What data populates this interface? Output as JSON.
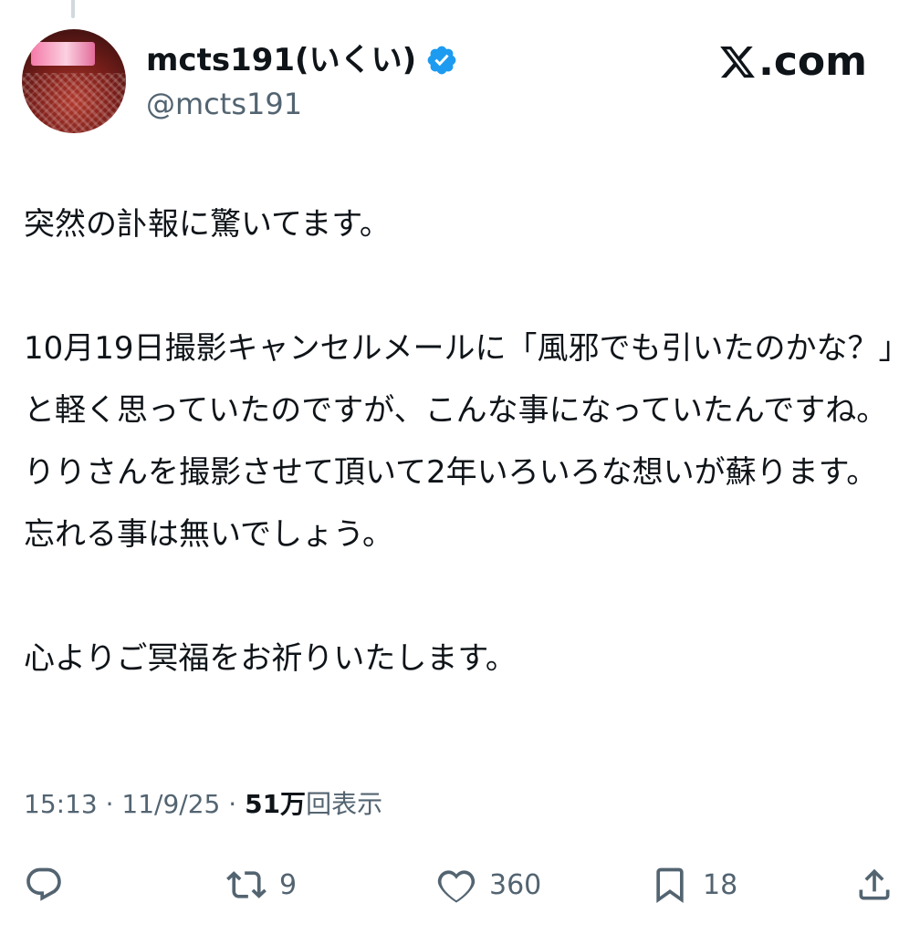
{
  "author": {
    "display_name": "mcts191(いくい)",
    "handle": "@mcts191",
    "verified": true,
    "verified_color": "#1d9bf0"
  },
  "site": {
    "logo_text": ".com",
    "logo_icon": "x-logo-icon"
  },
  "tweet": {
    "paragraphs": [
      "突然の訃報に驚いてます。",
      "",
      "10月19日撮影キャンセルメールに「風邪でも引いたのかな？」と軽く思っていたのですが、こんな事になっていたんですね。\nりりさんを撮影させて頂いて2年いろいろな想いが蘇ります。忘れる事は無いでしょう。",
      "",
      "心よりご冥福をお祈りいたします。"
    ],
    "time": "15:13",
    "date": "11/9/25",
    "separator": "·",
    "views_number": "51万",
    "views_label": "回表示"
  },
  "actions": {
    "reply_icon": "reply-icon",
    "repost_icon": "repost-icon",
    "repost_count": "9",
    "like_icon": "heart-icon",
    "like_count": "360",
    "bookmark_icon": "bookmark-icon",
    "bookmark_count": "18",
    "share_icon": "share-icon"
  },
  "colors": {
    "text_primary": "#0f1419",
    "text_secondary": "#536471"
  }
}
